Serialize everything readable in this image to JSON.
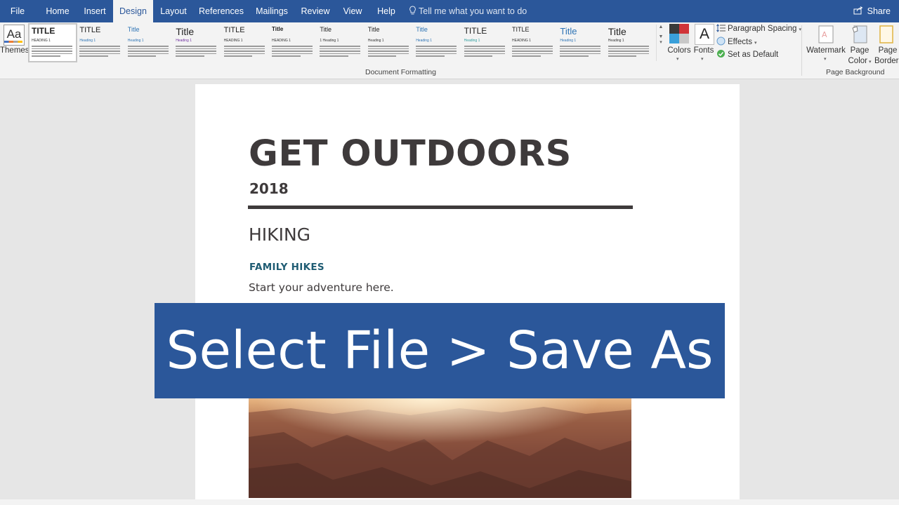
{
  "tabs": [
    "File",
    "Home",
    "Insert",
    "Design",
    "Layout",
    "References",
    "Mailings",
    "Review",
    "View",
    "Help"
  ],
  "active_tab": "Design",
  "tell_me": "Tell me what you want to do",
  "share_label": "Share",
  "ribbon": {
    "themes_label": "Themes",
    "style_gallery": [
      {
        "title": "TITLE",
        "heading": "HEADING 1"
      },
      {
        "title": "TITLE",
        "heading": "Heading 1"
      },
      {
        "title": "Title",
        "heading": "Heading 1"
      },
      {
        "title": "Title",
        "heading": "Heading 1"
      },
      {
        "title": "TITLE",
        "heading": "HEADING 1"
      },
      {
        "title": "Title",
        "heading": "HEADING 1"
      },
      {
        "title": "Title",
        "heading": "1 Heading 1"
      },
      {
        "title": "Title",
        "heading": "Heading 1"
      },
      {
        "title": "Title",
        "heading": "Heading 1"
      },
      {
        "title": "TITLE",
        "heading": "Heading 1"
      },
      {
        "title": "TITLE",
        "heading": "HEADING 1"
      },
      {
        "title": "Title",
        "heading": "Heading 1"
      },
      {
        "title": "Title",
        "heading": "Heading 1"
      }
    ],
    "document_formatting_label": "Document Formatting",
    "colors_label": "Colors",
    "fonts_label": "Fonts",
    "fonts_glyph": "A",
    "paragraph_spacing_label": "Paragraph Spacing",
    "effects_label": "Effects",
    "set_default_label": "Set as Default",
    "watermark_label": "Watermark",
    "page_color_label_1": "Page",
    "page_color_label_2": "Color",
    "page_borders_label_1": "Page",
    "page_borders_label_2": "Borders",
    "page_background_label": "Page Background"
  },
  "document": {
    "title": "GET OUTDOORS",
    "year": "2018",
    "heading1": "HIKING",
    "heading2": "FAMILY HIKES",
    "body": "Start your adventure here."
  },
  "overlay_caption": "Select File > Save As",
  "colors": {
    "accent": "#2b579a",
    "title_text": "#3e3a3b",
    "heading2": "#1f5c73"
  }
}
